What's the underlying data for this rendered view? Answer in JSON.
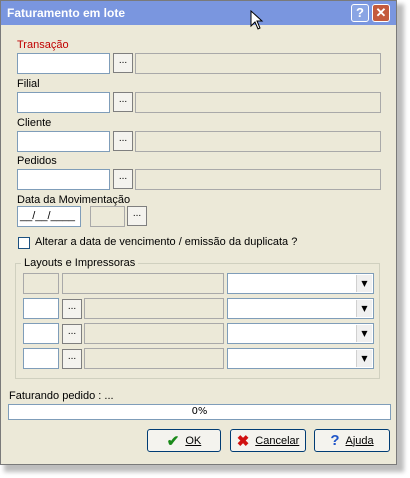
{
  "window": {
    "title": "Faturamento em lote",
    "help_glyph": "?",
    "close_glyph": "✕"
  },
  "fields": {
    "transacao_label": "Transação",
    "filial_label": "Filial",
    "cliente_label": "Cliente",
    "pedidos_label": "Pedidos",
    "data_label": "Data da Movimentação",
    "data_value": "__/__/____",
    "lookup_glyph": "..."
  },
  "checkbox": {
    "label": "Alterar a data de vencimento / emissão da duplicata ?"
  },
  "layouts": {
    "title": "Layouts e Impressoras",
    "dropdown_glyph": "▼"
  },
  "status": {
    "text": "Faturando pedido :  ...",
    "progress_value": 0,
    "progress_label": "0%"
  },
  "buttons": {
    "ok": "OK",
    "cancel": "Cancelar",
    "help": "Ajuda"
  },
  "colors": {
    "title_bg": "#7a96df",
    "required_label": "#c00000",
    "ok_icon": "#1a8a1a",
    "cancel_icon": "#d01010",
    "help_icon": "#1f55c8"
  }
}
